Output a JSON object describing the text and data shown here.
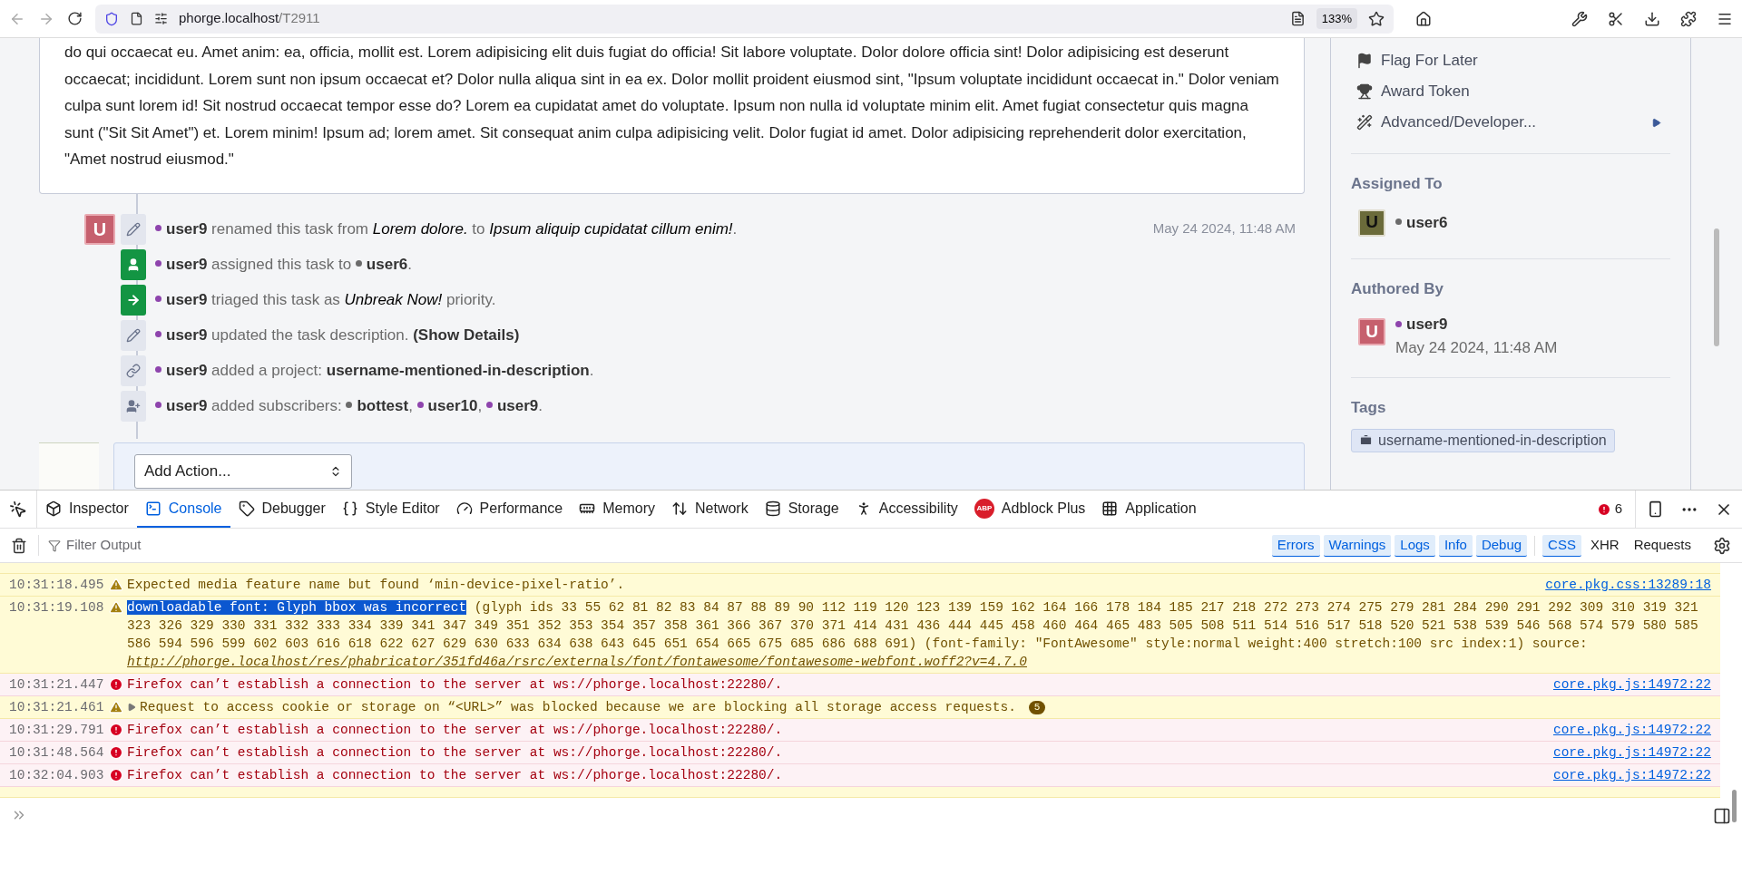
{
  "browser": {
    "url_host": "phorge.localhost",
    "url_path": "/T2911",
    "zoom": "133%"
  },
  "description": "do qui occaecat eu. Amet anim: ea, officia, mollit est. Lorem adipisicing elit duis fugiat do officia! Sit labore voluptate. Dolor dolore officia sint! Dolor adipisicing est deserunt occaecat; incididunt. Lorem sunt non ipsum occaecat et? Dolor nulla aliqua sint in ea ex. Dolor mollit proident eiusmod sint, \"Ipsum voluptate incididunt occaecat in.\" Dolor veniam culpa sunt lorem id! Sit nostrud occaecat tempor esse do? Lorem ea cupidatat amet do voluptate. Ipsum non nulla id voluptate minim elit. Amet fugiat consectetur quis magna sunt (\"Sit Sit Amet\") et. Lorem minim! Ipsum ad; lorem amet. Sit consequat anim culpa adipisicing velit. Dolor fugiat id amet. Dolor adipisicing reprehenderit dolor exercitation, \"Amet nostrud eiusmod.\"",
  "timeline": {
    "avatar_letter": "U",
    "date": "May 24 2024, 11:48 AM",
    "events": [
      {
        "kind": "pencil",
        "color": "#e3e6ee",
        "segments": [
          {
            "kind": "user",
            "text": "user9",
            "color": "#8e44ad"
          },
          {
            "kind": "plain",
            "text": " renamed this task from "
          },
          {
            "kind": "italic",
            "text": "Lorem dolore."
          },
          {
            "kind": "plain",
            "text": " to "
          },
          {
            "kind": "italic",
            "text": "Ipsum aliquip cupidatat cillum enim!"
          },
          {
            "kind": "plain",
            "text": "."
          }
        ]
      },
      {
        "kind": "user",
        "color": "#139543",
        "segments": [
          {
            "kind": "user",
            "text": "user9",
            "color": "#8e44ad"
          },
          {
            "kind": "plain",
            "text": " assigned this task to "
          },
          {
            "kind": "user",
            "text": "user6",
            "color": "#6b6b6b"
          },
          {
            "kind": "plain",
            "text": "."
          }
        ]
      },
      {
        "kind": "arrow",
        "color": "#139543",
        "segments": [
          {
            "kind": "user",
            "text": "user9",
            "color": "#8e44ad"
          },
          {
            "kind": "plain",
            "text": " triaged this task as "
          },
          {
            "kind": "italic",
            "text": "Unbreak Now!"
          },
          {
            "kind": "plain",
            "text": " priority."
          }
        ]
      },
      {
        "kind": "pencil",
        "color": "#e3e6ee",
        "segments": [
          {
            "kind": "user",
            "text": "user9",
            "color": "#8e44ad"
          },
          {
            "kind": "plain",
            "text": " updated the task description. "
          },
          {
            "kind": "bold",
            "text": "(Show Details)"
          }
        ]
      },
      {
        "kind": "link",
        "color": "#e3e6ee",
        "segments": [
          {
            "kind": "user",
            "text": "user9",
            "color": "#8e44ad"
          },
          {
            "kind": "plain",
            "text": " added a project: "
          },
          {
            "kind": "bold",
            "text": "username-mentioned-in-description"
          },
          {
            "kind": "plain",
            "text": "."
          }
        ]
      },
      {
        "kind": "user-plus",
        "color": "#e3e6ee",
        "segments": [
          {
            "kind": "user",
            "text": "user9",
            "color": "#8e44ad"
          },
          {
            "kind": "plain",
            "text": " added subscribers: "
          },
          {
            "kind": "user",
            "text": "bottest",
            "color": "#6b6b6b"
          },
          {
            "kind": "plain",
            "text": ", "
          },
          {
            "kind": "user",
            "text": "user10",
            "color": "#8e44ad"
          },
          {
            "kind": "plain",
            "text": ", "
          },
          {
            "kind": "user",
            "text": "user9",
            "color": "#8e44ad"
          },
          {
            "kind": "plain",
            "text": "."
          }
        ]
      }
    ]
  },
  "add_action": {
    "value": "Add Action..."
  },
  "sidebar": {
    "actions": [
      {
        "kind": "flag",
        "label": "Flag For Later",
        "submenu": false
      },
      {
        "kind": "trophy",
        "label": "Award Token",
        "submenu": false
      },
      {
        "kind": "wand",
        "label": "Advanced/Developer...",
        "submenu": true
      }
    ],
    "assigned": {
      "heading": "Assigned To",
      "avatar_letter": "U",
      "user": "user6",
      "color": "#6b6b6b"
    },
    "authored": {
      "heading": "Authored By",
      "avatar_letter": "U",
      "user": "user9",
      "color": "#8e44ad",
      "date": "May 24 2024, 11:48 AM"
    },
    "tags": {
      "heading": "Tags",
      "items": [
        "username-mentioned-in-description"
      ]
    }
  },
  "devtools": {
    "tabs": [
      {
        "kind": "inspector",
        "label": "Inspector",
        "selected": false
      },
      {
        "kind": "console",
        "label": "Console",
        "selected": true
      },
      {
        "kind": "debugger",
        "label": "Debugger",
        "selected": false
      },
      {
        "kind": "style",
        "label": "Style Editor",
        "selected": false
      },
      {
        "kind": "performance",
        "label": "Performance",
        "selected": false
      },
      {
        "kind": "memory",
        "label": "Memory",
        "selected": false
      },
      {
        "kind": "network",
        "label": "Network",
        "selected": false
      },
      {
        "kind": "storage",
        "label": "Storage",
        "selected": false
      },
      {
        "kind": "accessibility",
        "label": "Accessibility",
        "selected": false
      },
      {
        "kind": "abp",
        "label": "Adblock Plus",
        "badge_text": "ABP",
        "selected": false
      },
      {
        "kind": "application",
        "label": "Application",
        "selected": false
      }
    ],
    "error_count": "6",
    "filter_placeholder": "Filter Output",
    "filters": [
      {
        "label": "Errors",
        "selected": true
      },
      {
        "label": "Warnings",
        "selected": true
      },
      {
        "label": "Logs",
        "selected": true
      },
      {
        "label": "Info",
        "selected": true
      },
      {
        "label": "Debug",
        "selected": true
      },
      {
        "label": "CSS",
        "selected": true
      },
      {
        "label": "XHR",
        "selected": false
      },
      {
        "label": "Requests",
        "selected": false
      }
    ],
    "messages": [
      {
        "kind": "warning",
        "time": "10:31:18.495",
        "text": "Expected media feature name but found ‘min-device-pixel-ratio’.",
        "source": "core.pkg.css:13289:18"
      },
      {
        "kind": "warning",
        "time": "10:31:19.108",
        "highlight": "downloadable font: Glyph bbox was incorrect",
        "text": " (glyph ids 33 55 62 81 82 83 84 87 88 89 90 112 119 120 123 139 159 162 164 166 178 184 185 217 218 272 273 274 275 279 281 284 290 291 292 309 310 319 321 323 326 329 330 331 332 333 334 339 341 347 349 351 352 353 354 357 358 361 366 367 370 371 414 431 436 444 445 458 460 464 465 483 505 508 511 514 516 517 518 520 521 538 539 546 568 574 579 580 585 586 594 596 599 602 603 616 618 622 627 629 630 633 634 638 643 645 651 654 665 675 685 686 688 691) (font-family: \"FontAwesome\" style:normal weight:400 stretch:100 src index:1) source: ",
        "link": "http://phorge.localhost/res/phabricator/351fd46a/rsrc/externals/font/fontawesome/fontawesome-webfont.woff2?v=4.7.0"
      },
      {
        "kind": "error",
        "time": "10:31:21.447",
        "text": "Firefox can’t establish a connection to the server at ws://phorge.localhost:22280/.",
        "source": "core.pkg.js:14972:22"
      },
      {
        "kind": "warning",
        "time": "10:31:21.461",
        "expandable": true,
        "text": "Request to access cookie or storage on “<URL>” was blocked because we are blocking all storage access requests.",
        "count": "5"
      },
      {
        "kind": "error",
        "time": "10:31:29.791",
        "text": "Firefox can’t establish a connection to the server at ws://phorge.localhost:22280/.",
        "source": "core.pkg.js:14972:22"
      },
      {
        "kind": "error",
        "time": "10:31:48.564",
        "text": "Firefox can’t establish a connection to the server at ws://phorge.localhost:22280/.",
        "source": "core.pkg.js:14972:22"
      },
      {
        "kind": "error",
        "time": "10:32:04.903",
        "text": "Firefox can’t establish a connection to the server at ws://phorge.localhost:22280/.",
        "source": "core.pkg.js:14972:22"
      }
    ]
  }
}
